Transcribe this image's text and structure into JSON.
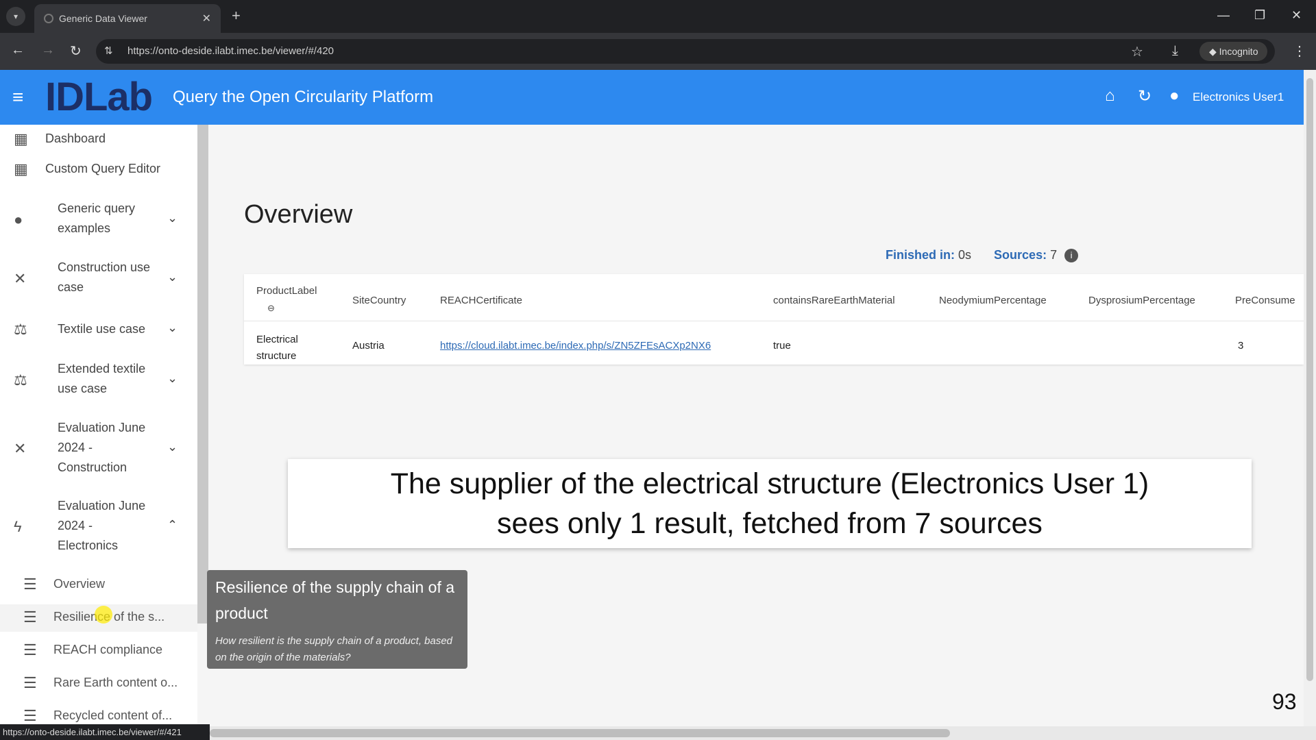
{
  "browser": {
    "tab_title": "Generic Data Viewer",
    "url": "https://onto-deside.ilabt.imec.be/viewer/#/420",
    "incognito_label": "Incognito",
    "status_url": "https://onto-deside.ilabt.imec.be/viewer/#/421"
  },
  "appbar": {
    "logo": "IDLab",
    "title": "Query the Open Circularity Platform",
    "user": "Electronics User1"
  },
  "sidebar": {
    "top_items": [
      {
        "label": "Dashboard",
        "icon": "dashboard-icon"
      },
      {
        "label": "Custom Query Editor",
        "icon": "apps-icon"
      }
    ],
    "groups": [
      {
        "label_lines": [
          "Generic query",
          "examples"
        ],
        "icon": "info-icon",
        "expanded": false
      },
      {
        "label_lines": [
          "Construction use",
          "case"
        ],
        "icon": "tools-icon",
        "expanded": false
      },
      {
        "label_lines": [
          "Textile use case"
        ],
        "icon": "textile-icon",
        "expanded": false
      },
      {
        "label_lines": [
          "Extended textile",
          "use case"
        ],
        "icon": "textile-icon",
        "expanded": false
      },
      {
        "label_lines": [
          "Evaluation June",
          "2024 -",
          "Construction"
        ],
        "icon": "tools-icon",
        "expanded": false
      },
      {
        "label_lines": [
          "Evaluation June",
          "2024 -",
          "Electronics"
        ],
        "icon": "bolt-icon",
        "expanded": true
      }
    ],
    "sub_items": [
      "Overview",
      "Resilience of the s...",
      "REACH compliance",
      "Rare Earth content o...",
      "Recycled content of..."
    ]
  },
  "main": {
    "title": "Overview",
    "finished_label": "Finished in:",
    "finished_value": "0s",
    "sources_label": "Sources:",
    "sources_value": "7",
    "table": {
      "columns": [
        "ProductLabel",
        "SiteCountry",
        "REACHCertificate",
        "containsRareEarthMaterial",
        "NeodymiumPercentage",
        "DysprosiumPercentage",
        "PreConsume"
      ],
      "rows": [
        [
          "Electrical structure",
          "Austria",
          "https://cloud.ilabt.imec.be/index.php/s/ZN5ZFEsACXp2NX6",
          "true",
          "",
          "",
          "3"
        ]
      ]
    }
  },
  "caption": {
    "line1": "The supplier of the electrical structure (Electronics User 1)",
    "line2": "sees only 1 result, fetched from 7 sources"
  },
  "tooltip": {
    "title": "Resilience of the supply chain of a product",
    "description": "How resilient is the supply chain of a product, based on the origin of the materials?"
  },
  "page_number": "93"
}
